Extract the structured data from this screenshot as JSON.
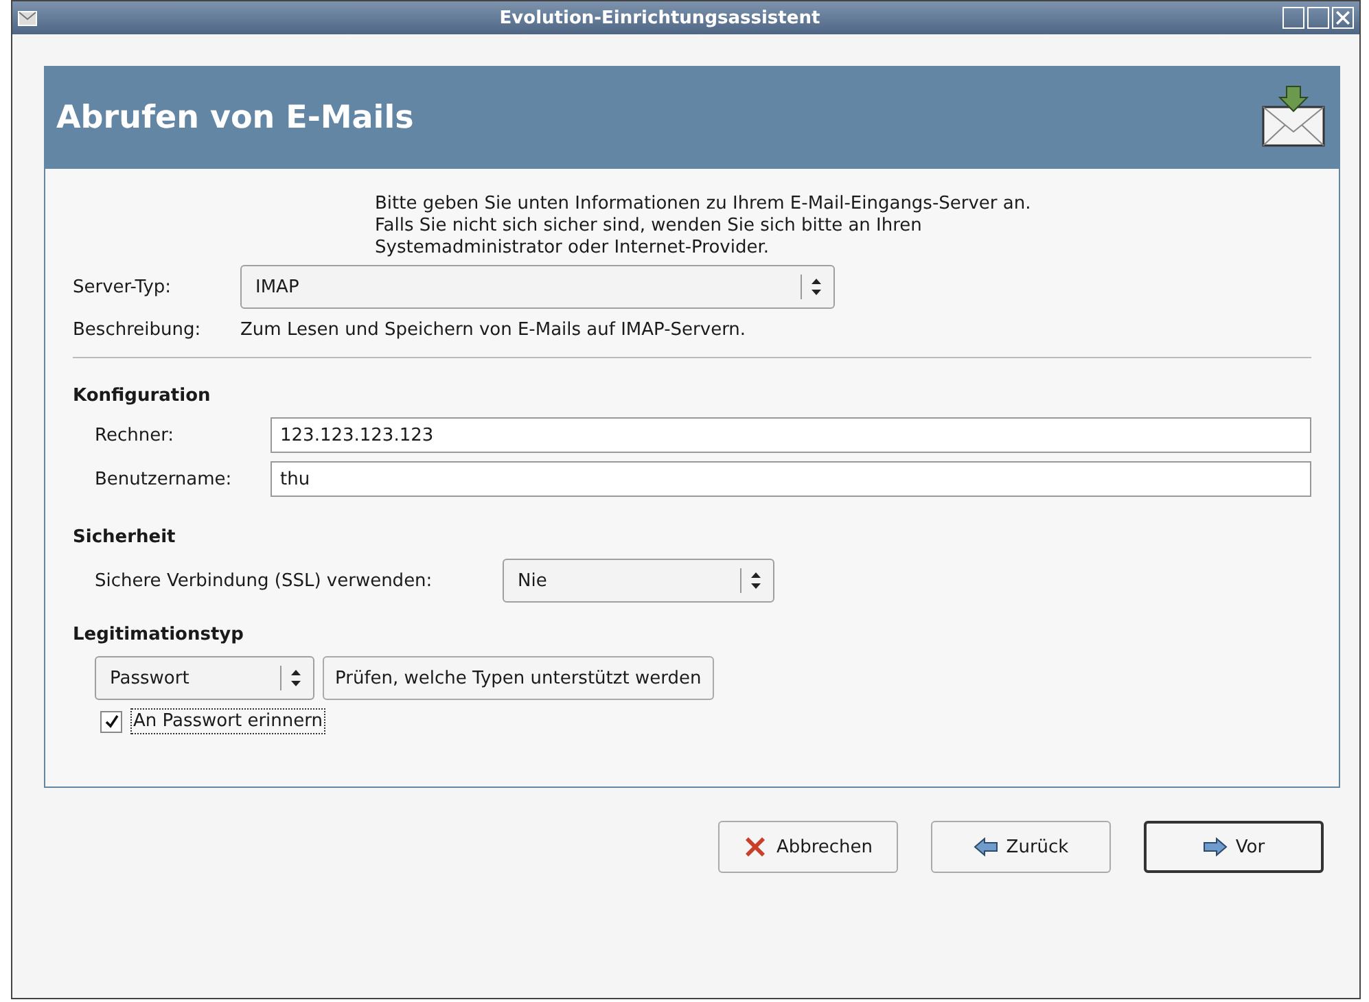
{
  "window": {
    "title": "Evolution-Einrichtungsassistent"
  },
  "header": {
    "title": "Abrufen von E-Mails"
  },
  "intro": "Bitte geben Sie unten Informationen zu Ihrem E-Mail-Eingangs-Server an. Falls Sie nicht sich sicher sind, wenden Sie sich bitte an Ihren Systemadministrator oder Internet-Provider.",
  "server_type": {
    "label": "Server-Typ:",
    "value": "IMAP"
  },
  "description": {
    "label": "Beschreibung:",
    "text": "Zum Lesen und Speichern von E-Mails auf IMAP-Servern."
  },
  "configuration": {
    "title": "Konfiguration",
    "fields": [
      {
        "label": "Rechner:",
        "value": "123.123.123.123"
      },
      {
        "label": "Benutzername:",
        "value": "thu"
      }
    ]
  },
  "security": {
    "title": "Sicherheit",
    "label": "Sichere Verbindung (SSL) verwenden:",
    "value": "Nie"
  },
  "authentication": {
    "title": "Legitimationstyp",
    "type": "Passwort",
    "check_button": "Prüfen, welche Typen unterstützt werden",
    "remember": {
      "label": "An Passwort erinnern",
      "checked": true
    }
  },
  "buttons": [
    {
      "label": "Abbrechen",
      "kind": "cancel",
      "default": false
    },
    {
      "label": "Zurück",
      "kind": "back",
      "default": false
    },
    {
      "label": "Vor",
      "kind": "forward",
      "default": true
    }
  ]
}
